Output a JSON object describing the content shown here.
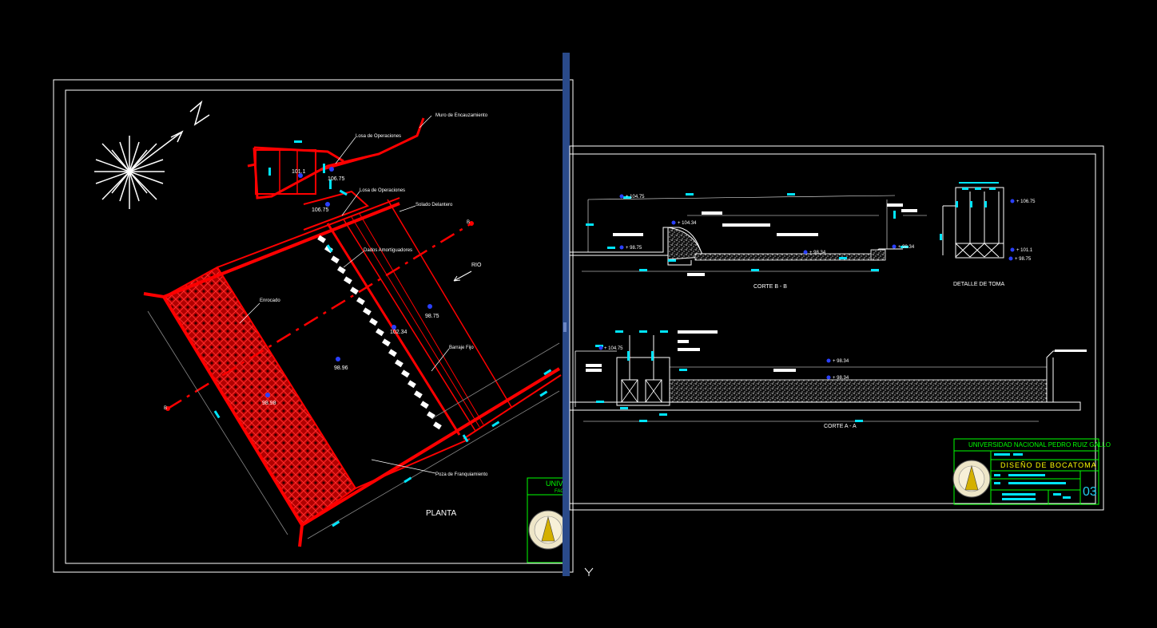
{
  "colors": {
    "background": "#000000",
    "structure": "#ff0000",
    "dimension": "#00e5ff",
    "text": "#ffffff",
    "elevation_marker": "#2a40ff",
    "title_block": "#00ff00",
    "title_text": "#ffff00",
    "divider": "#2a4a8a"
  },
  "plan": {
    "title": "PLANTA",
    "north_label": "N",
    "river_label": "RIO",
    "labels": {
      "muro_encauzamiento": "Muro de Encauzamiento",
      "losa_operaciones_1": "Losa de Operaciones",
      "losa_operaciones_2": "Losa de Operaciones",
      "solado_delantero": "Solado Delantero",
      "dados_amortiguadores": "Dados Amortiguadores",
      "enrocado": "Enrocado",
      "barraje_fijo": "Barraje Fijo",
      "poza_franquiamiento": "Poza de Franquiamiento"
    },
    "elevations": {
      "e1": "101.1",
      "e2": "106.75",
      "e3": "106.75",
      "e4": "102.34",
      "e5": "98.75",
      "e6": "98.96",
      "e7": "98.98"
    },
    "section_markers": {
      "a": "B",
      "b": "B"
    },
    "title_block": {
      "university": "UNIV",
      "faculty": "FAC"
    }
  },
  "sections": {
    "corte_b_title": "CORTE B - B",
    "corte_a_title": "CORTE A - A",
    "detalle_title": "DETALLE DE TOMA",
    "corte_b_elevations": {
      "e1": "+ 104.75",
      "e2": "+ 104.34",
      "e3": "+ 98.75",
      "e4": "+ 98.34",
      "e5": "+ 98.34"
    },
    "detalle_elevations": {
      "e1": "+ 106.75",
      "e2": "+ 101.1",
      "e3": "+ 98.75"
    },
    "corte_a_elevations": {
      "e1": "+ 104.75",
      "e2": "+ 98.34",
      "e3": "+ 98.34"
    }
  },
  "title_block": {
    "university": "UNIVERSIDAD NACIONAL PEDRO RUIZ GALLO",
    "project": "DISEÑO DE BOCATOMA",
    "sheet_number": "03"
  },
  "ucs_label": "Y"
}
